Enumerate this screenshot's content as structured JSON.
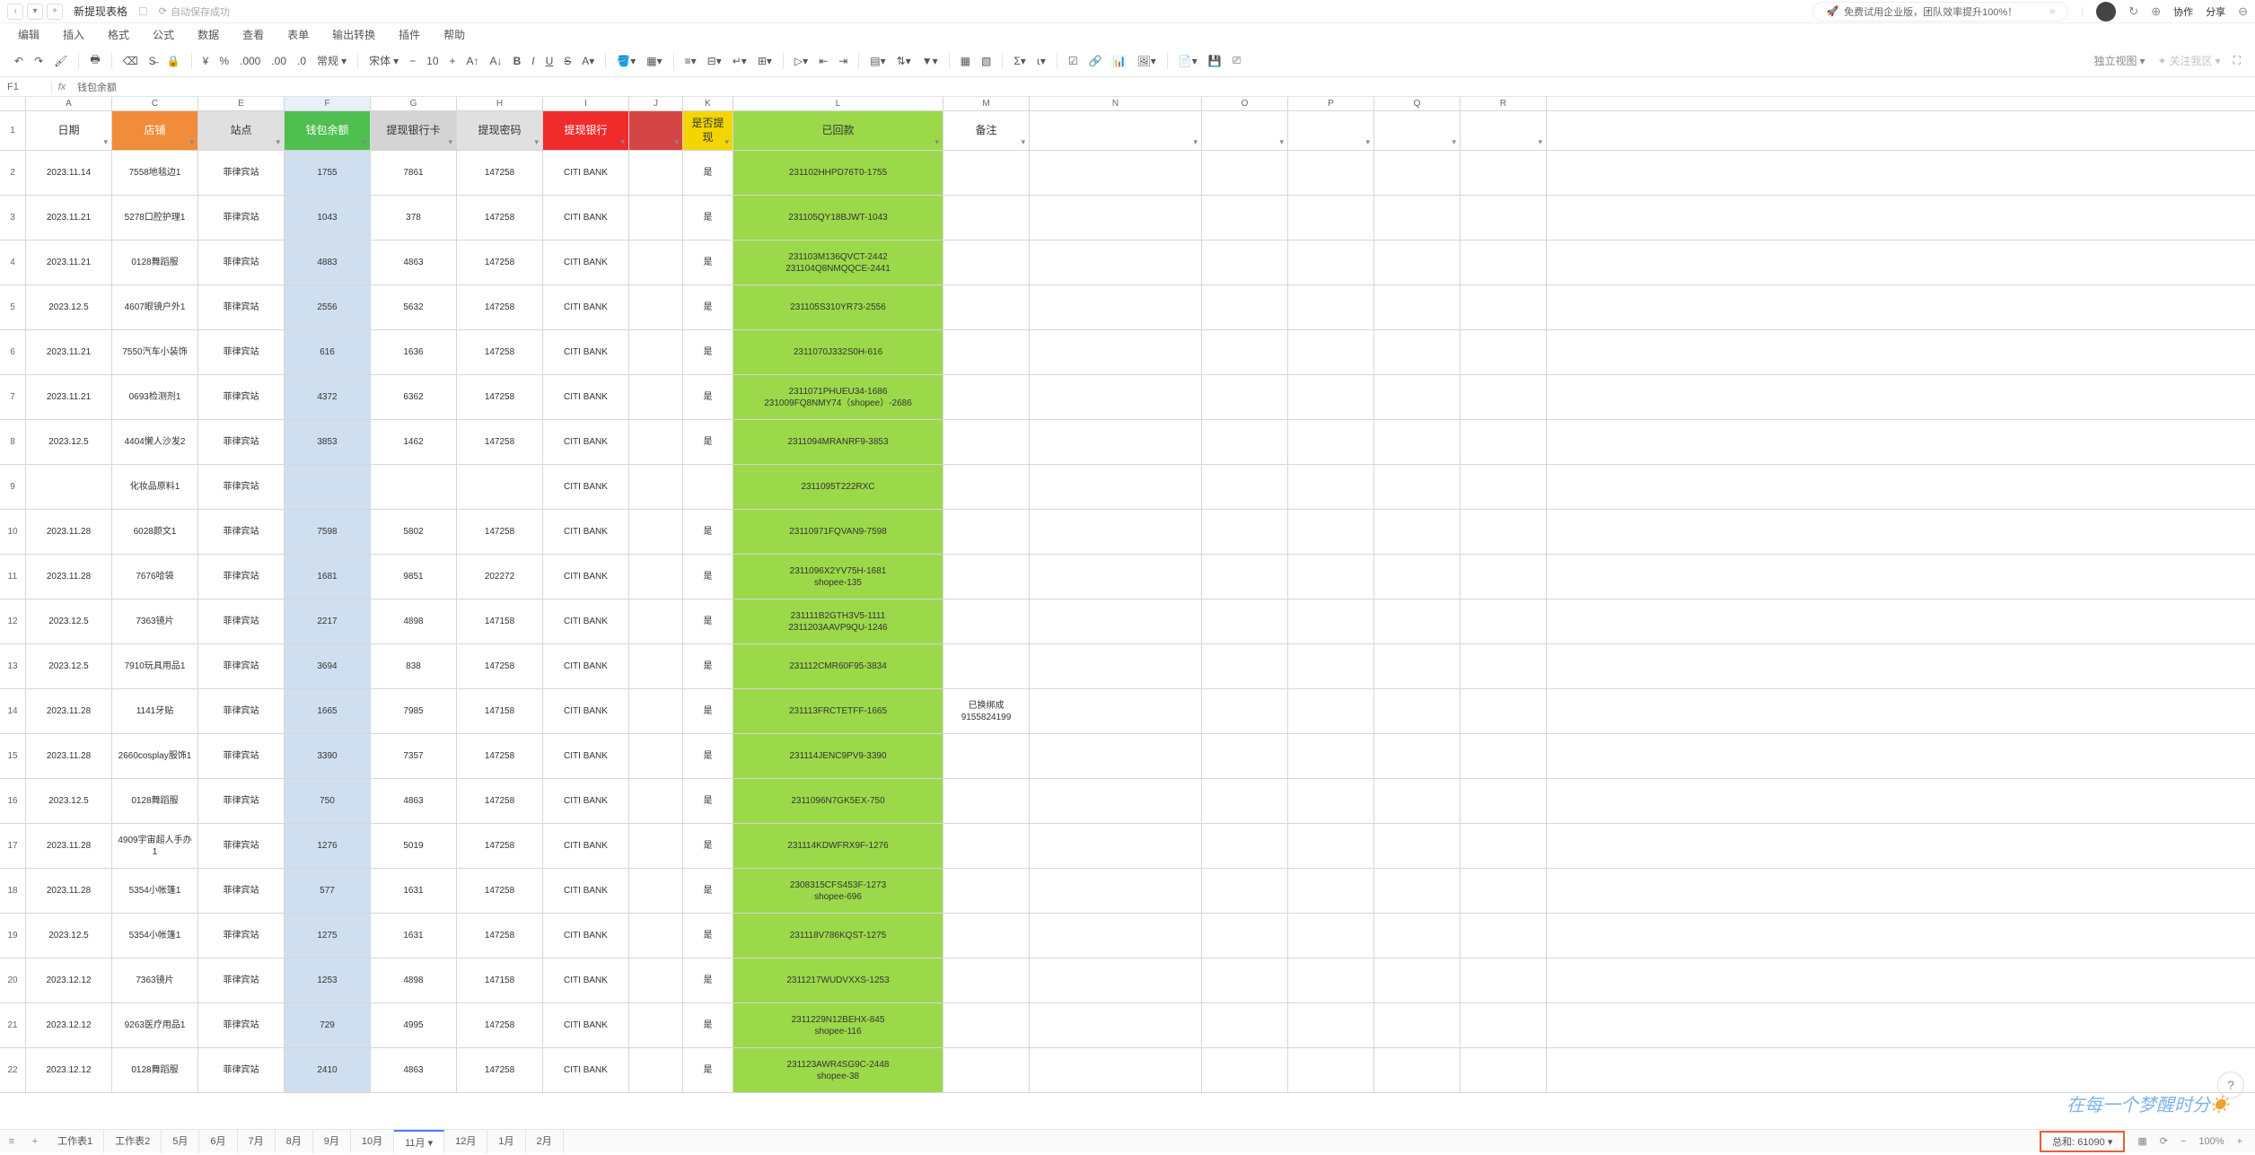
{
  "title": "新提现表格",
  "autosave": "自动保存成功",
  "promo": "免费试用企业版，团队效率提升100%！",
  "share": "分享",
  "collab": "协作",
  "menu": [
    "编辑",
    "插入",
    "格式",
    "公式",
    "数据",
    "查看",
    "表单",
    "输出转换",
    "插件",
    "帮助"
  ],
  "viewmode": "独立视图",
  "lockfocus": "关注我区",
  "font_name": "宋体",
  "font_size": "10",
  "number_format": "常规",
  "cellname": "F1",
  "fx": "fx",
  "formula_text": "钱包余额",
  "columns": [
    "A",
    "C",
    "E",
    "F",
    "G",
    "H",
    "I",
    "J",
    "K",
    "L",
    "M",
    "N",
    "O",
    "P",
    "Q",
    "R"
  ],
  "headers": {
    "row": "1",
    "A": "日期",
    "C": "店铺",
    "E": "站点",
    "F": "钱包余额",
    "G": "提现银行卡",
    "H": "提现密码",
    "I": "提现银行",
    "J": "",
    "K": "是否提现",
    "L": "已回款",
    "M": "备注",
    "N": "",
    "O": "",
    "P": "",
    "Q": "",
    "R": ""
  },
  "rows": [
    {
      "n": "2",
      "A": "2023.11.14",
      "C": "7558地毯边1",
      "E": "菲律宾站",
      "F": "1755",
      "G": "7861",
      "H": "147258",
      "I": "CITI BANK",
      "K": "是",
      "L": "231102HHPD76T0-1755"
    },
    {
      "n": "3",
      "A": "2023.11.21",
      "C": "5278口腔护理1",
      "E": "菲律宾站",
      "F": "1043",
      "G": "378",
      "H": "147258",
      "I": "CITI BANK",
      "K": "是",
      "L": "231105QY18BJWT-1043"
    },
    {
      "n": "4",
      "A": "2023.11.21",
      "C": "0128舞蹈服",
      "E": "菲律宾站",
      "F": "4883",
      "G": "4863",
      "H": "147258",
      "I": "CITI BANK",
      "K": "是",
      "L": "231103M136QVCT-2442\n231104Q8NMQQCE-2441"
    },
    {
      "n": "5",
      "A": "2023.12.5",
      "C": "4607眼镜户外1",
      "E": "菲律宾站",
      "F": "2556",
      "G": "5632",
      "H": "147258",
      "I": "CITI BANK",
      "K": "是",
      "L": "231105S310YR73-2556"
    },
    {
      "n": "6",
      "A": "2023.11.21",
      "C": "7550汽车小装饰",
      "E": "菲律宾站",
      "F": "616",
      "G": "1636",
      "H": "147258",
      "I": "CITI BANK",
      "K": "是",
      "L": "2311070J332S0H-616"
    },
    {
      "n": "7",
      "A": "2023.11.21",
      "C": "0693检测剂1",
      "E": "菲律宾站",
      "F": "4372",
      "G": "6362",
      "H": "147258",
      "I": "CITI BANK",
      "K": "是",
      "L": "2311071PHUEU34-1686\n231009FQ8NMY74（shopee）-2686"
    },
    {
      "n": "8",
      "A": "2023.12.5",
      "C": "4404懒人沙发2",
      "E": "菲律宾站",
      "F": "3853",
      "G": "1462",
      "H": "147258",
      "I": "CITI BANK",
      "K": "是",
      "L": "2311094MRANRF9-3853"
    },
    {
      "n": "9",
      "A": "",
      "C": "化妆品原料1",
      "E": "菲律宾站",
      "F": "",
      "G": "",
      "H": "",
      "I": "CITI BANK",
      "K": "",
      "L": "2311095T222RXC"
    },
    {
      "n": "10",
      "A": "2023.11.28",
      "C": "6028颜文1",
      "E": "菲律宾站",
      "F": "7598",
      "G": "5802",
      "H": "147258",
      "I": "CITI BANK",
      "K": "是",
      "L": "23110971FQVAN9-7598"
    },
    {
      "n": "11",
      "A": "2023.11.28",
      "C": "7676哈袋",
      "E": "菲律宾站",
      "F": "1681",
      "G": "9851",
      "H": "202272",
      "I": "CITI BANK",
      "K": "是",
      "L": "2311096X2YV75H-1681\nshopee-135"
    },
    {
      "n": "12",
      "A": "2023.12.5",
      "C": "7363镜片",
      "E": "菲律宾站",
      "F": "2217",
      "G": "4898",
      "H": "147158",
      "I": "CITI BANK",
      "K": "是",
      "L": "231111B2GTH3V5-1111\n2311203AAVP9QU-1246"
    },
    {
      "n": "13",
      "A": "2023.12.5",
      "C": "7910玩具用品1",
      "E": "菲律宾站",
      "F": "3694",
      "G": "838",
      "H": "147258",
      "I": "CITI BANK",
      "K": "是",
      "L": "231112CMR60F95-3834"
    },
    {
      "n": "14",
      "A": "2023.11.28",
      "C": "1141牙贴",
      "E": "菲律宾站",
      "F": "1665",
      "G": "7985",
      "H": "147158",
      "I": "CITI BANK",
      "K": "是",
      "L": "231113FRCTETFF-1665",
      "M": "已换绑成9155824199"
    },
    {
      "n": "15",
      "A": "2023.11.28",
      "C": "2660cosplay服饰1",
      "E": "菲律宾站",
      "F": "3390",
      "G": "7357",
      "H": "147258",
      "I": "CITI BANK",
      "K": "是",
      "L": "231114JENC9PV9-3390"
    },
    {
      "n": "16",
      "A": "2023.12.5",
      "C": "0128舞蹈服",
      "E": "菲律宾站",
      "F": "750",
      "G": "4863",
      "H": "147258",
      "I": "CITI BANK",
      "K": "是",
      "L": "2311096N7GK5EX-750"
    },
    {
      "n": "17",
      "A": "2023.11.28",
      "C": "4909宇宙超人手办1",
      "E": "菲律宾站",
      "F": "1276",
      "G": "5019",
      "H": "147258",
      "I": "CITI BANK",
      "K": "是",
      "L": "231114KDWFRX9F-1276"
    },
    {
      "n": "18",
      "A": "2023.11.28",
      "C": "5354小帐篷1",
      "E": "菲律宾站",
      "F": "577",
      "G": "1631",
      "H": "147258",
      "I": "CITI BANK",
      "K": "是",
      "L": "2308315CFS453F-1273\nshopee-696"
    },
    {
      "n": "19",
      "A": "2023.12.5",
      "C": "5354小帐篷1",
      "E": "菲律宾站",
      "F": "1275",
      "G": "1631",
      "H": "147258",
      "I": "CITI BANK",
      "K": "是",
      "L": "231118V786KQST-1275"
    },
    {
      "n": "20",
      "A": "2023.12.12",
      "C": "7363镜片",
      "E": "菲律宾站",
      "F": "1253",
      "G": "4898",
      "H": "147158",
      "I": "CITI BANK",
      "K": "是",
      "L": "2311217WUDVXXS-1253"
    },
    {
      "n": "21",
      "A": "2023.12.12",
      "C": "9263医疗用品1",
      "E": "菲律宾站",
      "F": "729",
      "G": "4995",
      "H": "147258",
      "I": "CITI BANK",
      "K": "是",
      "L": "2311229N12BEHX-845\nshopee-116"
    },
    {
      "n": "22",
      "A": "2023.12.12",
      "C": "0128舞蹈服",
      "E": "菲律宾站",
      "F": "2410",
      "G": "4863",
      "H": "147258",
      "I": "CITI BANK",
      "K": "是",
      "L": "231123AWR4SG9C-2448\nshopee-38"
    }
  ],
  "sheettabs": [
    "工作表1",
    "工作表2",
    "5月",
    "6月",
    "7月",
    "8月",
    "9月",
    "10月",
    "11月",
    "12月",
    "1月",
    "2月"
  ],
  "active_tab": "11月",
  "status_sum": "总和: 61090",
  "zoom": "100%",
  "watermark": "在每一个梦醒时分"
}
